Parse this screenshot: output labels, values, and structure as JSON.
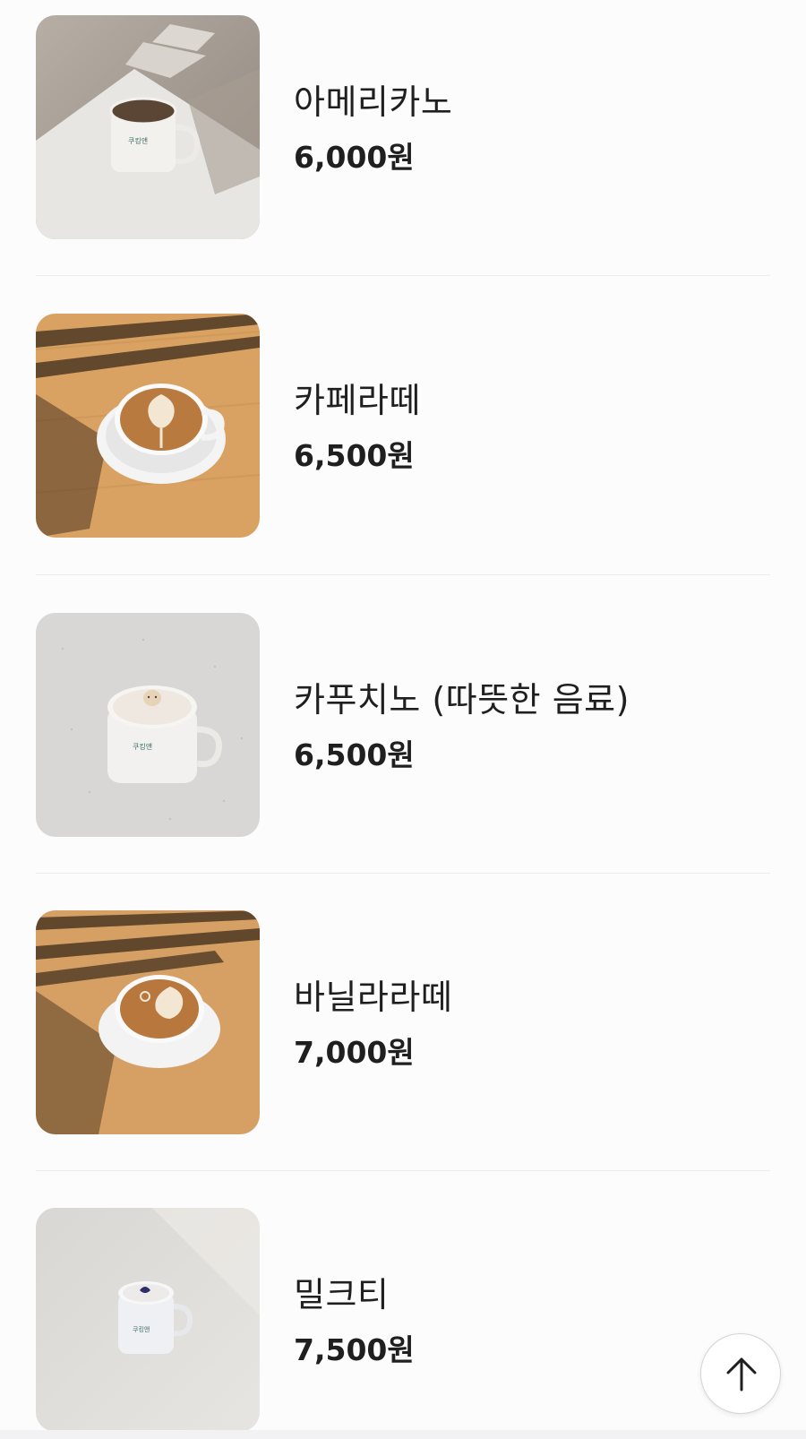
{
  "menu": {
    "items": [
      {
        "name": "아메리카노",
        "price": "6,000원",
        "image_icon": "americano-mug-photo"
      },
      {
        "name": "카페라떼",
        "price": "6,500원",
        "image_icon": "cafe-latte-cup-photo"
      },
      {
        "name": "카푸치노 (따뜻한 음료)",
        "price": "6,500원",
        "image_icon": "cappuccino-cup-photo"
      },
      {
        "name": "바닐라라떼",
        "price": "7,000원",
        "image_icon": "vanilla-latte-cup-photo"
      },
      {
        "name": "밀크티",
        "price": "7,500원",
        "image_icon": "milk-tea-cup-photo"
      }
    ]
  },
  "scroll_top": {
    "icon": "arrow-up-icon"
  },
  "colors": {
    "background": "#fcfcfd",
    "text": "#1f1f1f",
    "divider": "#ececee",
    "wood": "#d9a263",
    "counter": "#dcdcdc"
  }
}
